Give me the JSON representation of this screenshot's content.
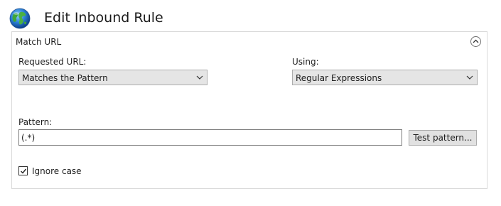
{
  "window": {
    "title": "Edit Inbound Rule",
    "icon": "globe-icon"
  },
  "group": {
    "title": "Match URL",
    "collapse_icon": "chevron-up-icon"
  },
  "requested_url": {
    "label": "Requested URL:",
    "selected": "Matches the Pattern"
  },
  "using": {
    "label": "Using:",
    "selected": "Regular Expressions"
  },
  "pattern": {
    "label": "Pattern:",
    "value": "(.*)"
  },
  "test_pattern_button": {
    "label": "Test pattern..."
  },
  "ignore_case": {
    "label": "Ignore case",
    "checked": true
  },
  "colors": {
    "select_background": "#e5e5e5",
    "button_background": "#e1e1e1",
    "border": "#adadad"
  }
}
